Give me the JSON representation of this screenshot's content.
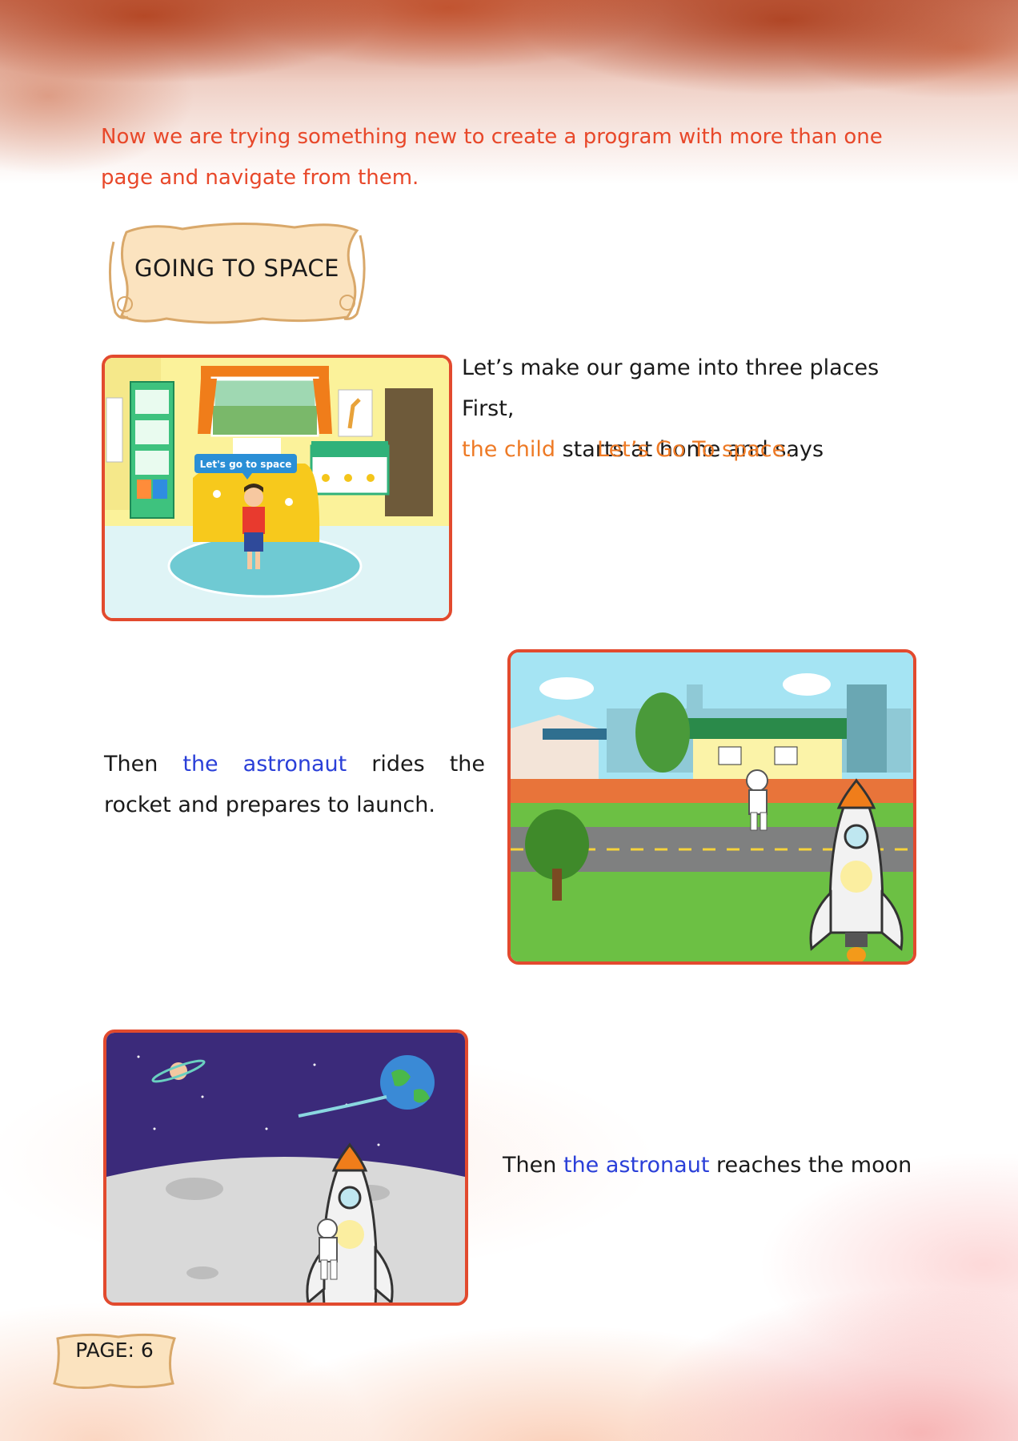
{
  "intro": {
    "text": "Now we are trying something new to create a program with more than one page and navigate from them."
  },
  "banner": {
    "title": "GOING TO SPACE"
  },
  "scene1": {
    "bubble": "Let's go to space",
    "text_part1": "Let’s make our game into three places First,",
    "highlight": "the child",
    "text_part2": "starts at home and says",
    "quote": "Let’s Go To space."
  },
  "scene2": {
    "text_part1": "Then",
    "highlight": "the astronaut",
    "text_part2": "rides the rocket and prepares to launch."
  },
  "scene3": {
    "text_part1": "Then",
    "highlight": "the astronaut",
    "text_part2": "reaches the moon"
  },
  "footer": {
    "page_label": "PAGE: 6"
  },
  "colors": {
    "intro_text": "#e8482a",
    "highlight_orange": "#ee7a25",
    "highlight_blue": "#2a3fd8",
    "frame_border": "#e24a2e"
  }
}
